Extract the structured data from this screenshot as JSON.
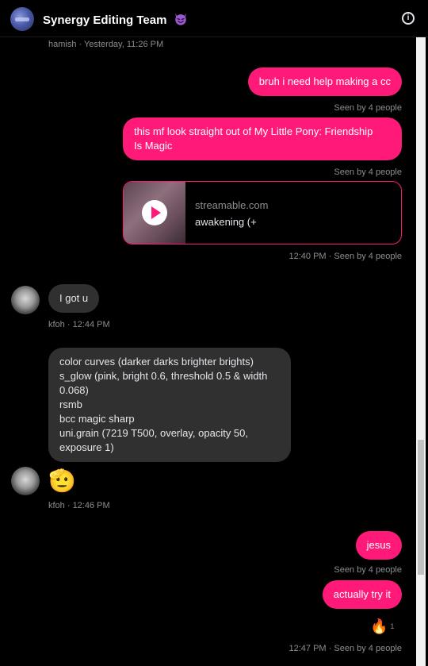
{
  "header": {
    "title": "Synergy Editing Team",
    "emoji": "😈"
  },
  "messages": {
    "top_meta": "hamish · Yesterday, 11:26 PM",
    "m1": {
      "text": "bruh i need help making a cc",
      "seen": "Seen by 4 people"
    },
    "m2": {
      "line1": "this mf look straight out of My Little Pony: Friendship",
      "line2": "Is Magic",
      "seen": "Seen by 4 people"
    },
    "link": {
      "domain": "streamable.com",
      "title": "awakening (+",
      "meta": "12:40 PM · Seen by 4 people"
    },
    "m3": {
      "text": "I got u",
      "meta": "kfoh · 12:44 PM"
    },
    "m4": {
      "lines": [
        "color curves (darker darks brighter brights)",
        "s_glow (pink, bright 0.6, threshold 0.5 & width",
        "0.068)",
        "rsmb",
        "bcc magic sharp",
        "uni.grain (7219 T500, overlay, opacity 50,",
        "exposure 1)"
      ],
      "emoji": "🫡",
      "meta": "kfoh · 12:46 PM"
    },
    "m5": {
      "text": "jesus",
      "seen": "Seen by 4 people"
    },
    "m6": {
      "text": "actually try it",
      "reaction": "🔥",
      "reaction_count": "1",
      "meta": "12:47 PM · Seen by 4 people"
    }
  },
  "colors": {
    "accent": "#ff1a7a",
    "incoming_bubble": "#303030",
    "background": "#000000"
  }
}
